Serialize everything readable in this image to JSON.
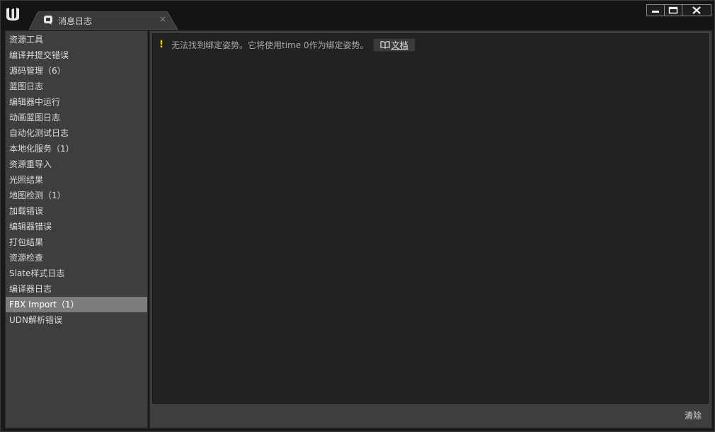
{
  "window": {
    "tab_title": "消息日志",
    "tab_close": "×"
  },
  "categories": [
    {
      "label": "资源工具"
    },
    {
      "label": "编译并提交错误"
    },
    {
      "label": "源码管理（6）"
    },
    {
      "label": "蓝图日志"
    },
    {
      "label": "编辑器中运行"
    },
    {
      "label": "动画蓝图日志"
    },
    {
      "label": "自动化测试日志"
    },
    {
      "label": "本地化服务（1）"
    },
    {
      "label": "资源重导入"
    },
    {
      "label": "光照结果"
    },
    {
      "label": "地图检测（1）"
    },
    {
      "label": "加载错误"
    },
    {
      "label": "编辑器错误"
    },
    {
      "label": "打包结果"
    },
    {
      "label": "资源检查"
    },
    {
      "label": "Slate样式日志"
    },
    {
      "label": "编译器日志"
    },
    {
      "label": "FBX Import（1）",
      "selected": true
    },
    {
      "label": "UDN解析错误"
    }
  ],
  "messages": [
    {
      "severity": "warning",
      "icon": "!",
      "text": "无法找到绑定姿势。它将使用time 0作为绑定姿势。",
      "doc_button": "文档"
    }
  ],
  "footer": {
    "clear_label": "清除"
  },
  "colors": {
    "warning": "#f2c200",
    "selected_row": "#7b7b7b",
    "panel": "#3e3e3e",
    "log_bg": "#222222"
  }
}
